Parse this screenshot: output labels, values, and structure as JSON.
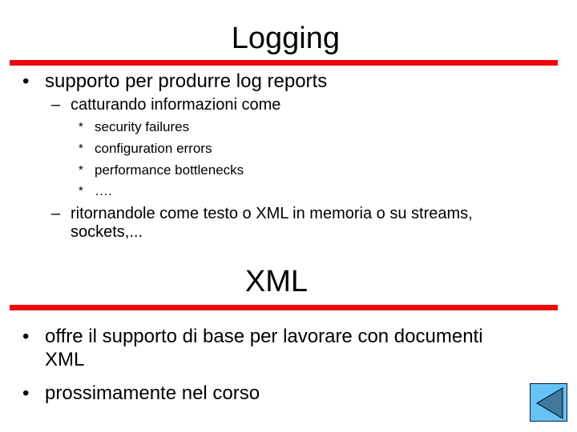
{
  "slides": [
    {
      "title": "Logging",
      "bullets": [
        {
          "text": "supporto per produrre log reports",
          "sub": [
            {
              "text": "catturando informazioni come",
              "items": [
                "security failures",
                "configuration errors",
                "performance bottlenecks",
                "…."
              ]
            },
            {
              "text_line1": "ritornandole come testo o XML in memoria o su streams,",
              "text_line2": "sockets,..."
            }
          ]
        }
      ]
    },
    {
      "title": "XML",
      "bullets": [
        {
          "text_line1": "offre il supporto di base per lavorare con documenti",
          "text_line2": "XML"
        },
        {
          "text": "prossimamente nel corso"
        }
      ]
    }
  ],
  "symbols": {
    "bullet": "•",
    "dash": "–",
    "star": "*"
  },
  "nav": {
    "back_button_icon": "triangle-left-icon"
  },
  "colors": {
    "rule": "#ee0a0a",
    "nav_fill": "#66c3f5",
    "nav_triangle": "#3f7a9c"
  }
}
